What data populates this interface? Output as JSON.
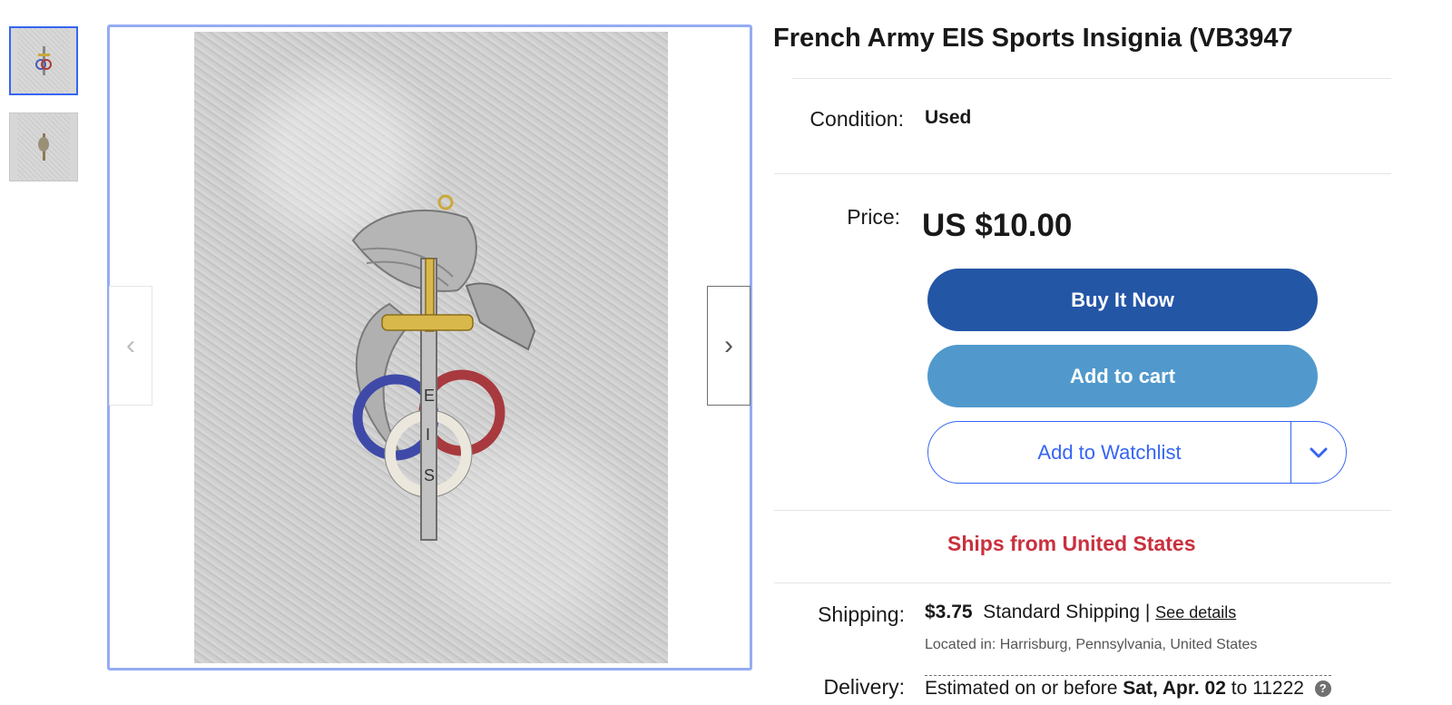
{
  "item": {
    "title": "French Army EIS Sports Insignia (VB3947",
    "photo_alt": "Insignia photo"
  },
  "gallery": {
    "prev_icon": "chevron-left-icon",
    "next_icon": "chevron-right-icon",
    "prev_glyph": "‹",
    "next_glyph": "›"
  },
  "condition": {
    "label": "Condition:",
    "value": "Used"
  },
  "price": {
    "label": "Price:",
    "value": "US $10.00"
  },
  "actions": {
    "buy_now": "Buy It Now",
    "add_to_cart": "Add to cart",
    "watchlist": "Add to Watchlist"
  },
  "ships_from": "Ships from United States",
  "shipping": {
    "label": "Shipping:",
    "cost": "$3.75",
    "method": "Standard Shipping |",
    "see_details": "See details",
    "located_label": "Located in:",
    "located_value": "Harrisburg, Pennsylvania, United States"
  },
  "delivery": {
    "label": "Delivery:",
    "text_before": "Estimated on or before",
    "date": "Sat, Apr. 02",
    "text_after": "to 11222"
  },
  "colors": {
    "buy": "#2456a6",
    "cart": "#5199cc",
    "watch": "#3665f3",
    "ships": "#c9303e",
    "viewer_border": "#94acf2"
  }
}
